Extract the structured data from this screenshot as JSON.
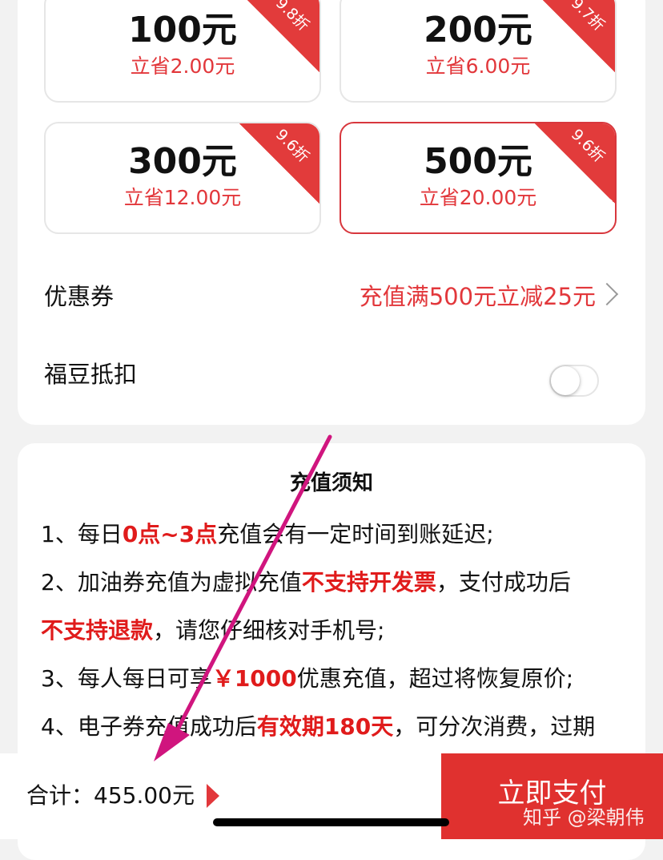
{
  "recharge_options": [
    {
      "amount": "100元",
      "saving": "立省2.00元",
      "discount": "9.8折"
    },
    {
      "amount": "200元",
      "saving": "立省6.00元",
      "discount": "9.7折"
    },
    {
      "amount": "300元",
      "saving": "立省12.00元",
      "discount": "9.6折"
    },
    {
      "amount": "500元",
      "saving": "立省20.00元",
      "discount": "9.6折",
      "selected": true
    }
  ],
  "coupon": {
    "label": "优惠券",
    "value": "充值满500元立减25元"
  },
  "fudou": {
    "label": "福豆抵扣",
    "enabled": false
  },
  "notice": {
    "title": "充值须知",
    "l1_a": "1、每日",
    "l1_b": "0点~3点",
    "l1_c": "充值会有一定时间到账延迟;",
    "l2_a": "2、加油券充值为虚拟充值",
    "l2_b": "不支持开发票",
    "l2_c": "，支付成功后",
    "l3_a": "不支持退款",
    "l3_b": "，请您仔细核对手机号;",
    "l4_a": "3、每人每日可享",
    "l4_b": "￥1000",
    "l4_c": "优惠充值，超过将恢复原价;",
    "l5_a": "4、电子券充值成功后",
    "l5_b": "有效期180天",
    "l5_c": "，可分次消费，过期"
  },
  "footer": {
    "total": "合计：455.00元",
    "pay_button": "立即支付"
  },
  "watermark": "知乎 @梁朝伟",
  "colors": {
    "accent": "#e2373b",
    "annotation_arrow": "#d0157e"
  }
}
